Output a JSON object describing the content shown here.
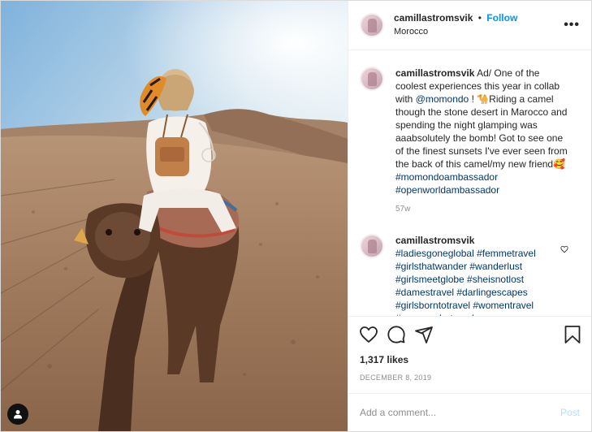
{
  "header": {
    "username": "camillastromsvik",
    "separator": "•",
    "follow_label": "Follow",
    "location": "Morocco",
    "more_icon": "•••"
  },
  "caption": {
    "username": "camillastromsvik",
    "text_1": "Ad/ One of the coolest experiences this year in collab with ",
    "mention": "@momondo",
    "text_2": " ! 🐪Riding a camel though the stone desert in Marocco and spending the night glamping was aaabsolutely the bomb! Got to see one of the finest sunsets I've ever seen from the back of this camel/my new friend🥰",
    "hashtag_1": "#momondoambassador",
    "hashtag_2": "#openworldambassador",
    "time": "57w"
  },
  "comment": {
    "username": "camillastromsvik",
    "hashtags": "#ladiesgoneglobal #femmetravel #girlsthatwander #wanderlust #girlsmeetglobe #sheisnotlost #damestravel #darlingescapes #girlsborntotravel #womentravel #womenwhotravel"
  },
  "likes": "1,317 likes",
  "date": "DECEMBER 8, 2019",
  "add_comment": {
    "placeholder": "Add a comment...",
    "post_label": "Post"
  },
  "icons": [
    "heart-icon",
    "comment-icon",
    "share-icon",
    "bookmark-icon",
    "user-tag-icon",
    "more-icon"
  ],
  "colors": {
    "accent": "#0095f6",
    "post_disabled": "#b2dffc",
    "link": "#00376b",
    "muted": "#8e8e8e"
  }
}
